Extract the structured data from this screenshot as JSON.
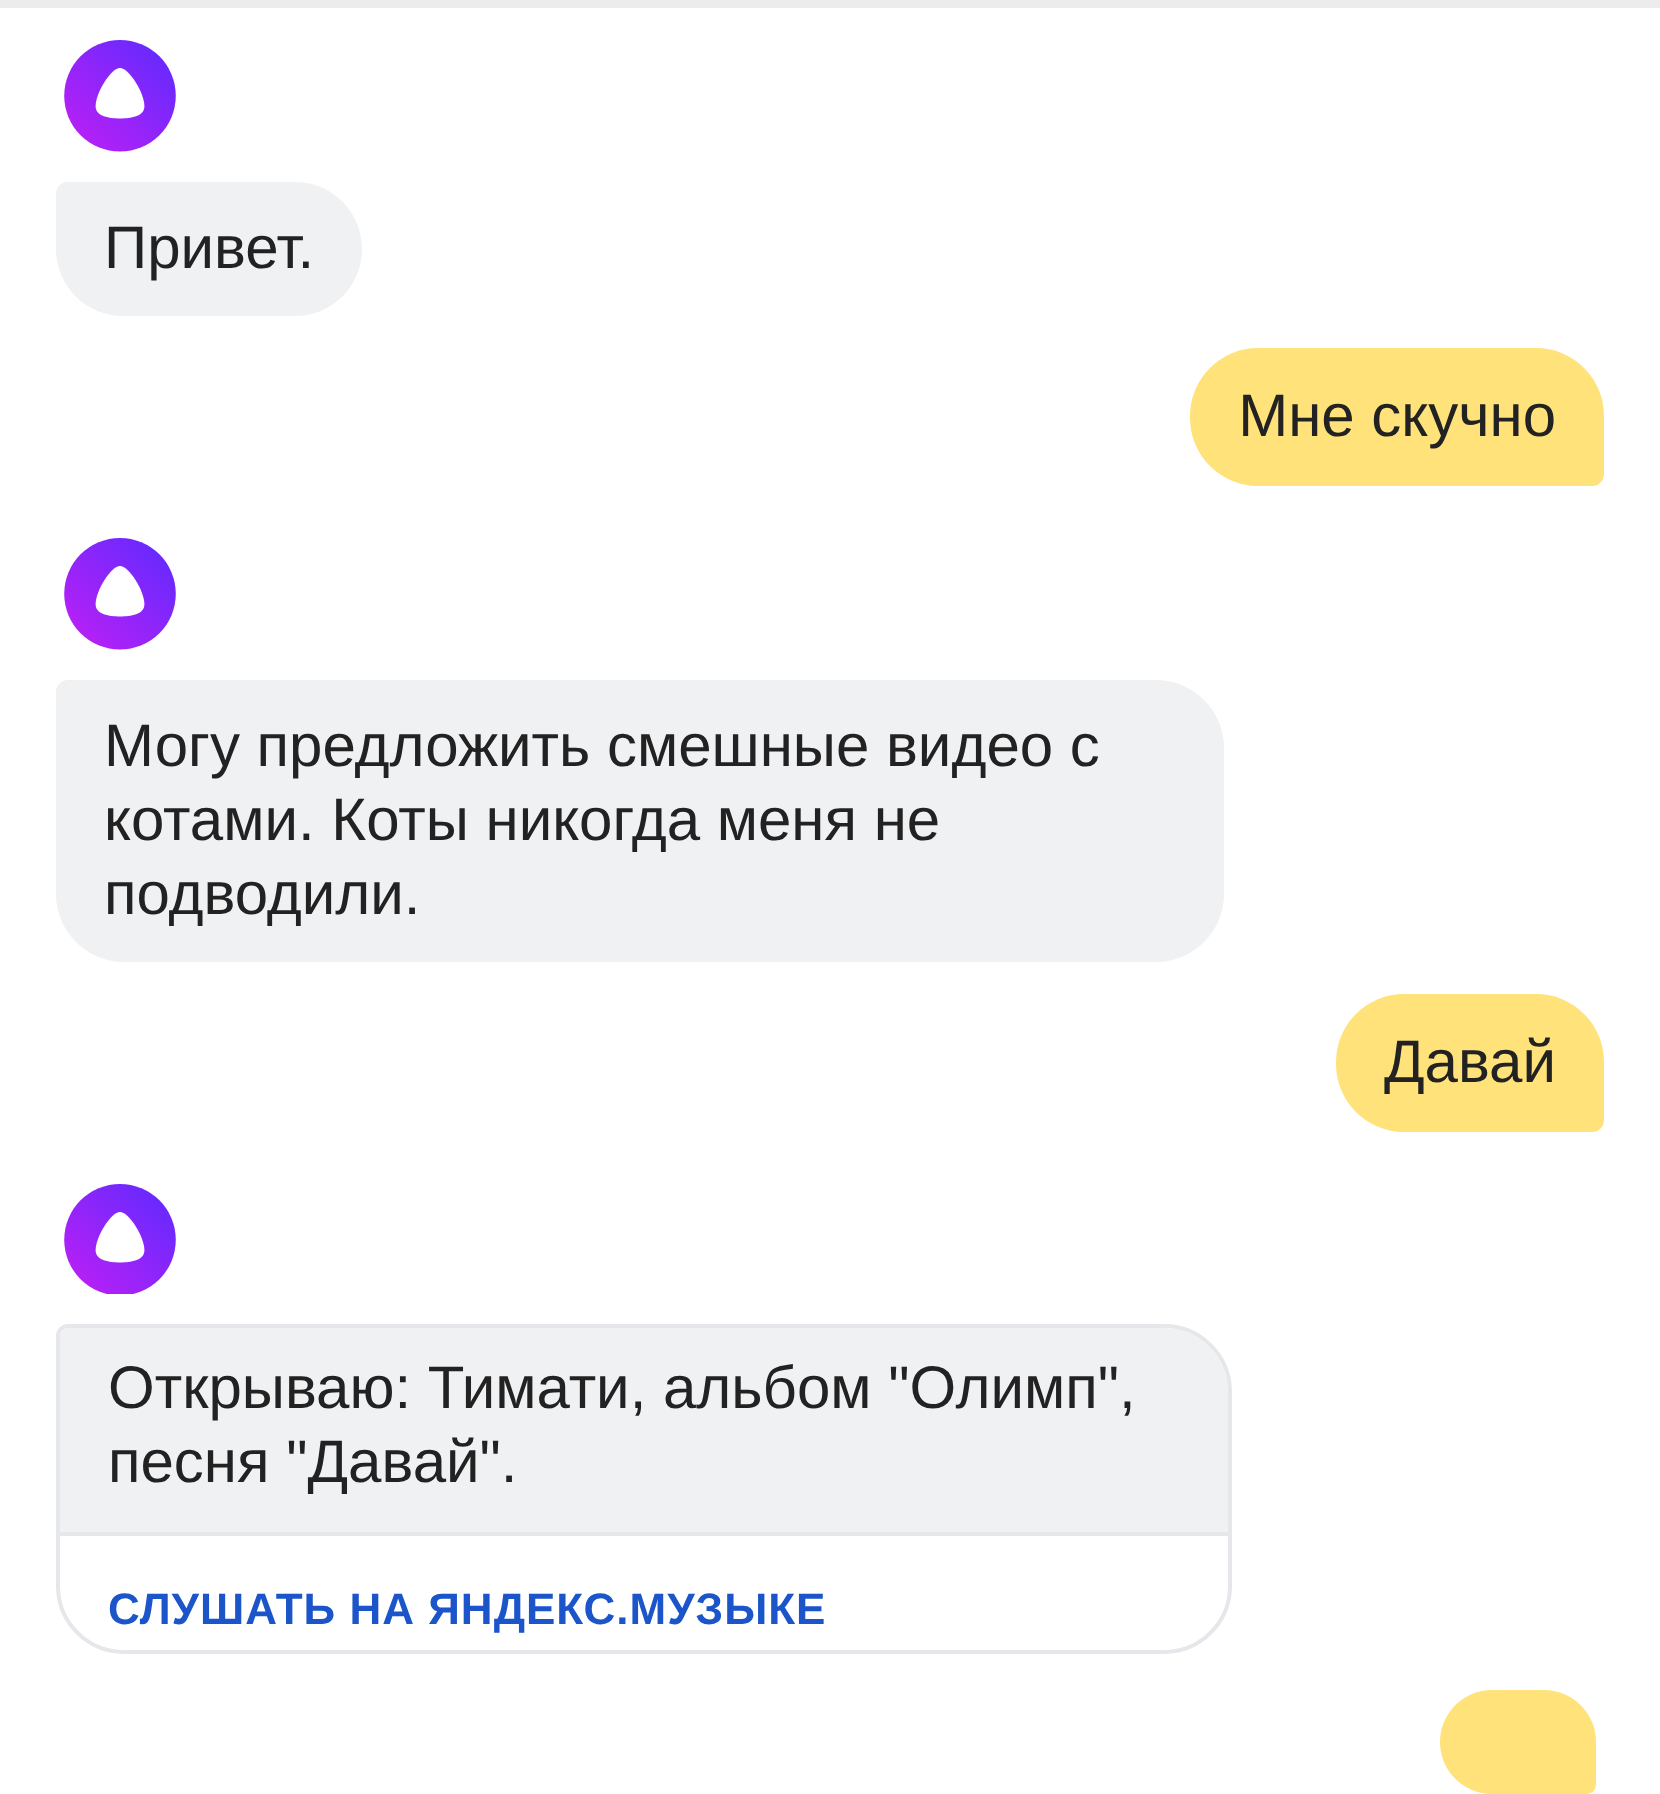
{
  "messages": [
    {
      "kind": "incoming",
      "text": "Привет."
    },
    {
      "kind": "outgoing",
      "text": "Мне скучно"
    },
    {
      "kind": "incoming",
      "text": "Могу предложить смешные видео с котами. Коты никогда меня не подводили."
    },
    {
      "kind": "outgoing",
      "text": "Давай"
    },
    {
      "kind": "incoming",
      "text": "Открываю: Тимати, альбом \"Олимп\", песня \"Давай\".",
      "action": "СЛУШАТЬ НА ЯНДЕКС.МУЗЫКЕ"
    },
    {
      "kind": "outgoing"
    }
  ]
}
